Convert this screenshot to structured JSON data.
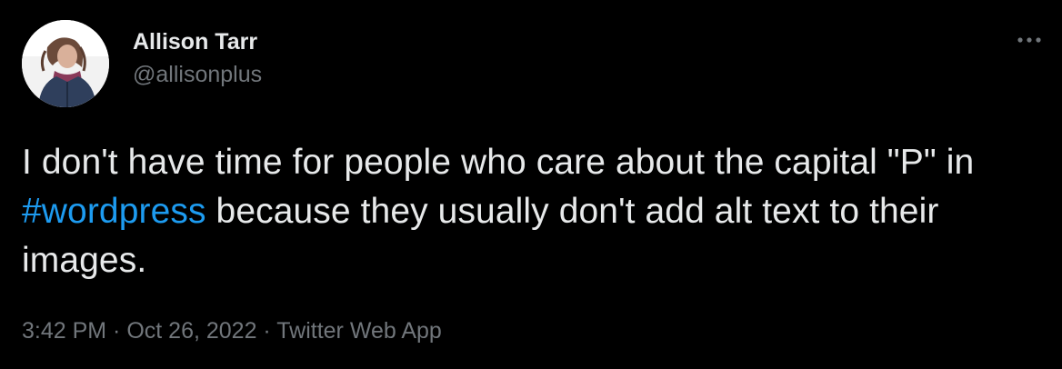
{
  "author": {
    "display_name": "Allison Tarr",
    "handle": "@allisonplus"
  },
  "tweet": {
    "text_before": "I don't have time for people who care about the capital \"P\" in ",
    "hashtag": "#wordpress",
    "text_after": " because they usually don't add alt text to their images."
  },
  "meta": {
    "time": "3:42 PM",
    "separator1": " · ",
    "date": "Oct 26, 2022",
    "separator2": " · ",
    "source": "Twitter Web App"
  },
  "icons": {
    "more": "more-icon"
  },
  "colors": {
    "background": "#000000",
    "text": "#e7e9ea",
    "secondary": "#71767b",
    "link": "#1d9bf0"
  }
}
